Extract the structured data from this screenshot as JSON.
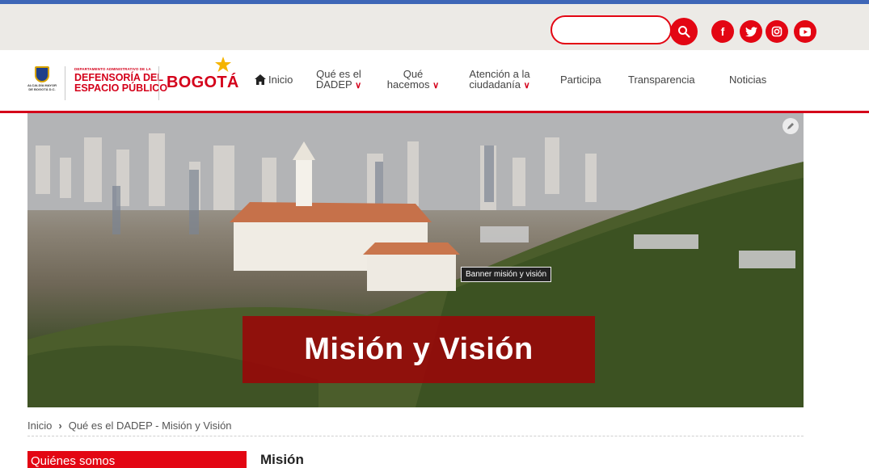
{
  "topbar": {
    "search": {
      "value": "",
      "placeholder": ""
    },
    "social": [
      "facebook-icon",
      "twitter-icon",
      "instagram-icon",
      "youtube-icon"
    ],
    "accent": "#e30613",
    "top_border": "#3e66b7"
  },
  "header": {
    "alcaldia_text": "ALCALDÍA MAYOR DE BOGOTÁ D.C.",
    "dadep_small": "DEPARTAMENTO ADMINISTRATIVO DE LA",
    "dadep_line1": "DEFENSORÍA DEL",
    "dadep_line2": "ESPACIO PÚBLICO",
    "bogota": "BOGOTÁ"
  },
  "nav": {
    "inicio": "Inicio",
    "que_es_1": "Qué es el",
    "que_es_2": "DADEP",
    "que_hacemos_1": "Qué",
    "que_hacemos_2": "hacemos",
    "atencion_1": "Atención a la",
    "atencion_2": "ciudadanía",
    "participa": "Participa",
    "transparencia": "Transparencia",
    "noticias": "Noticias"
  },
  "banner": {
    "tooltip": "Banner misión y visión",
    "title": "Misión y Visión"
  },
  "breadcrumb": {
    "home": "Inicio",
    "current": "Qué es el DADEP - Misión y Visión"
  },
  "sidebar": {
    "heading": "Quiénes somos"
  },
  "content": {
    "title": "Misión"
  }
}
